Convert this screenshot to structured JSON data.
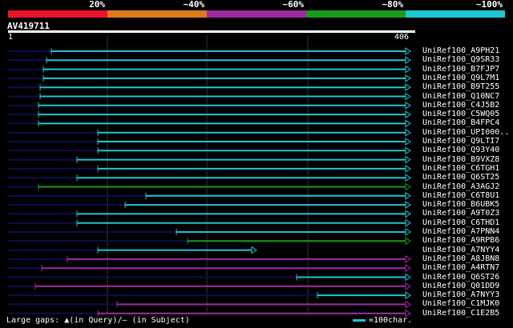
{
  "legend": {
    "segments": [
      {
        "label": "20%",
        "color": "#e9152a"
      },
      {
        "label": "~40%",
        "color": "#e07b1a"
      },
      {
        "label": "~60%",
        "color": "#9c2a9f"
      },
      {
        "label": "~80%",
        "color": "#179c1a"
      },
      {
        "label": "~100%",
        "color": "#1fc6d3"
      }
    ]
  },
  "query": {
    "title": "AV419711",
    "start": "1",
    "end": "406"
  },
  "colors": {
    "cyan": "#1fc6d3",
    "green": "#179c1a",
    "purple": "#a22ba7",
    "navy": "#0d0d55",
    "grid": "#333333"
  },
  "hits": [
    {
      "label": "UniRef100_A9PH21",
      "color": "cyan",
      "s": 64,
      "e": 512
    },
    {
      "label": "UniRef100_Q9SR33",
      "color": "cyan",
      "s": 58,
      "e": 512
    },
    {
      "label": "UniRef100_B7FJP7",
      "color": "cyan",
      "s": 54,
      "e": 512
    },
    {
      "label": "UniRef100_Q9L7M1",
      "color": "cyan",
      "s": 54,
      "e": 512
    },
    {
      "label": "UniRef100_B9T255",
      "color": "cyan",
      "s": 50,
      "e": 512
    },
    {
      "label": "UniRef100_Q10NC7",
      "color": "cyan",
      "s": 50,
      "e": 512
    },
    {
      "label": "UniRef100_C4J5B2",
      "color": "cyan",
      "s": 48,
      "e": 512
    },
    {
      "label": "UniRef100_C5WQ05",
      "color": "cyan",
      "s": 48,
      "e": 512
    },
    {
      "label": "UniRef100_B4FPC4",
      "color": "cyan",
      "s": 48,
      "e": 512
    },
    {
      "label": "UniRef100_UPI000..",
      "color": "cyan",
      "s": 122,
      "e": 512
    },
    {
      "label": "UniRef100_Q9LTI7",
      "color": "cyan",
      "s": 122,
      "e": 512
    },
    {
      "label": "UniRef100_Q93Y40",
      "color": "cyan",
      "s": 122,
      "e": 512
    },
    {
      "label": "UniRef100_B9VXZ8",
      "color": "cyan",
      "s": 96,
      "e": 512
    },
    {
      "label": "UniRef100_C6TGH1",
      "color": "cyan",
      "s": 122,
      "e": 512
    },
    {
      "label": "UniRef100_Q6ST25",
      "color": "cyan",
      "s": 96,
      "e": 512
    },
    {
      "label": "UniRef100_A3AGJ2",
      "color": "green",
      "s": 48,
      "e": 512
    },
    {
      "label": "UniRef100_C6T8U1",
      "color": "cyan",
      "s": 182,
      "e": 512
    },
    {
      "label": "UniRef100_B6UBK5",
      "color": "cyan",
      "s": 156,
      "e": 512
    },
    {
      "label": "UniRef100_A9T0Z3",
      "color": "cyan",
      "s": 96,
      "e": 512
    },
    {
      "label": "UniRef100_C6THD1",
      "color": "cyan",
      "s": 96,
      "e": 512
    },
    {
      "label": "UniRef100_A7PNN4",
      "color": "cyan",
      "s": 220,
      "e": 512
    },
    {
      "label": "UniRef100_A9RPB6",
      "color": "green",
      "s": 234,
      "e": 512
    },
    {
      "label": "UniRef100_A7NYY4",
      "color": "cyan",
      "s": 122,
      "e": 320
    },
    {
      "label": "UniRef100_A8JBN8",
      "color": "purple",
      "s": 84,
      "e": 512
    },
    {
      "label": "UniRef100_A4RTN7",
      "color": "purple",
      "s": 52,
      "e": 512
    },
    {
      "label": "UniRef100_Q6ST26",
      "color": "cyan",
      "s": 370,
      "e": 512
    },
    {
      "label": "UniRef100_Q01DD9",
      "color": "purple",
      "s": 44,
      "e": 512
    },
    {
      "label": "UniRef100_A7NYY3",
      "color": "cyan",
      "s": 396,
      "e": 512
    },
    {
      "label": "UniRef100_C1MJK0",
      "color": "purple",
      "s": 146,
      "e": 512
    },
    {
      "label": "UniRef100_C1E2B5",
      "color": "purple",
      "s": 122,
      "e": 512
    }
  ],
  "footer": {
    "text": "Large gaps: ▲(in Query)/– (in Subject)",
    "scale_label": "=100char."
  }
}
